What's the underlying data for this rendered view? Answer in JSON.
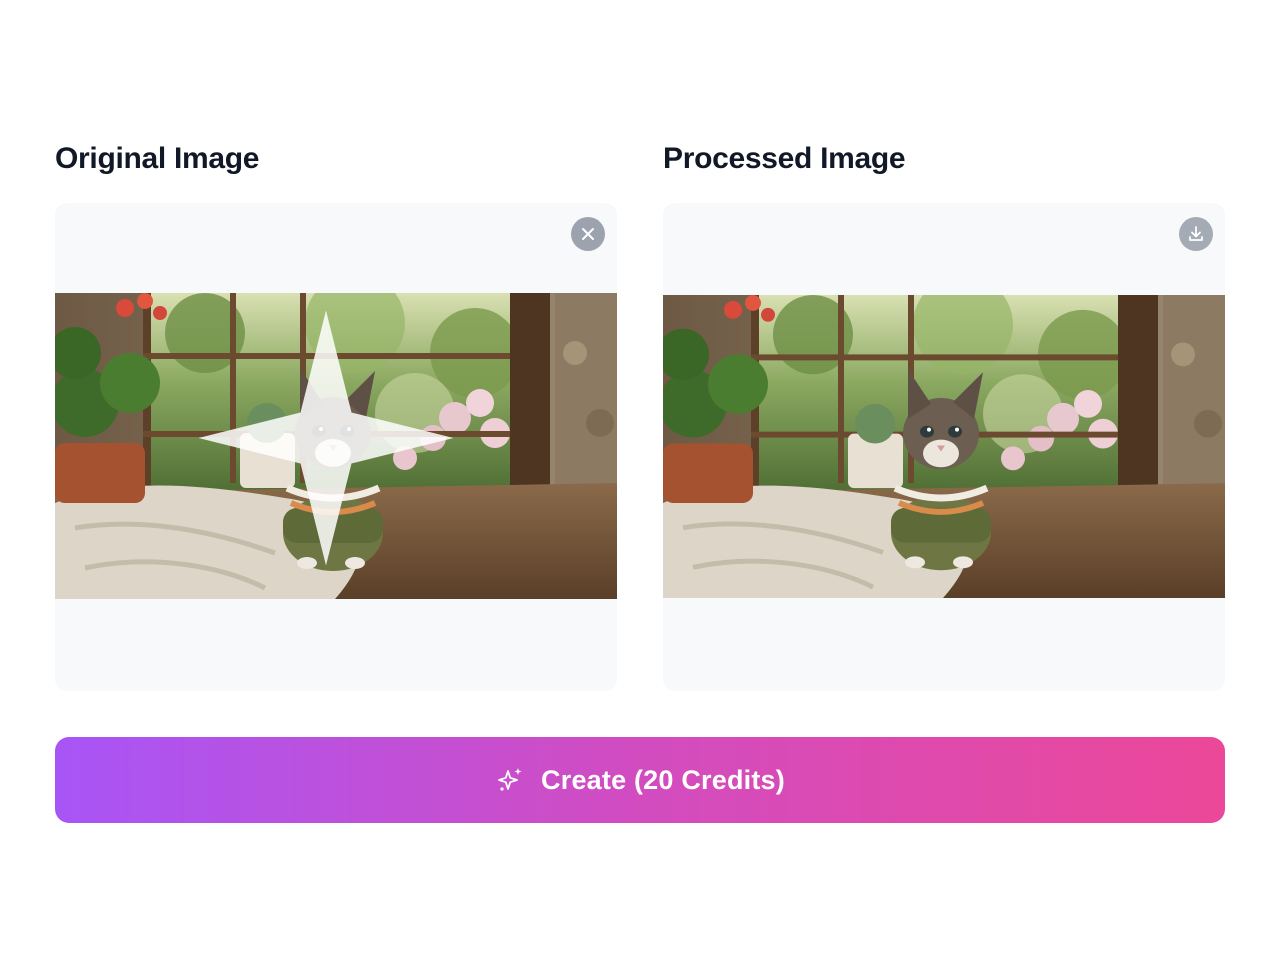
{
  "panels": {
    "original": {
      "title": "Original Image",
      "image_alt": "Kitten in a knitted sweater sitting on a rustic window sill",
      "action_icon": "close-icon"
    },
    "processed": {
      "title": "Processed Image",
      "image_alt": "Processed kitten in a knitted sweater on a rustic window sill",
      "action_icon": "download-icon"
    }
  },
  "create_button": {
    "label": "Create (20 Credits)",
    "icon": "sparkles-icon"
  },
  "colors": {
    "button_gradient_start": "#a855f7",
    "button_gradient_end": "#ec4899",
    "panel_bg": "#f8f9fb",
    "title_text": "#111827"
  }
}
